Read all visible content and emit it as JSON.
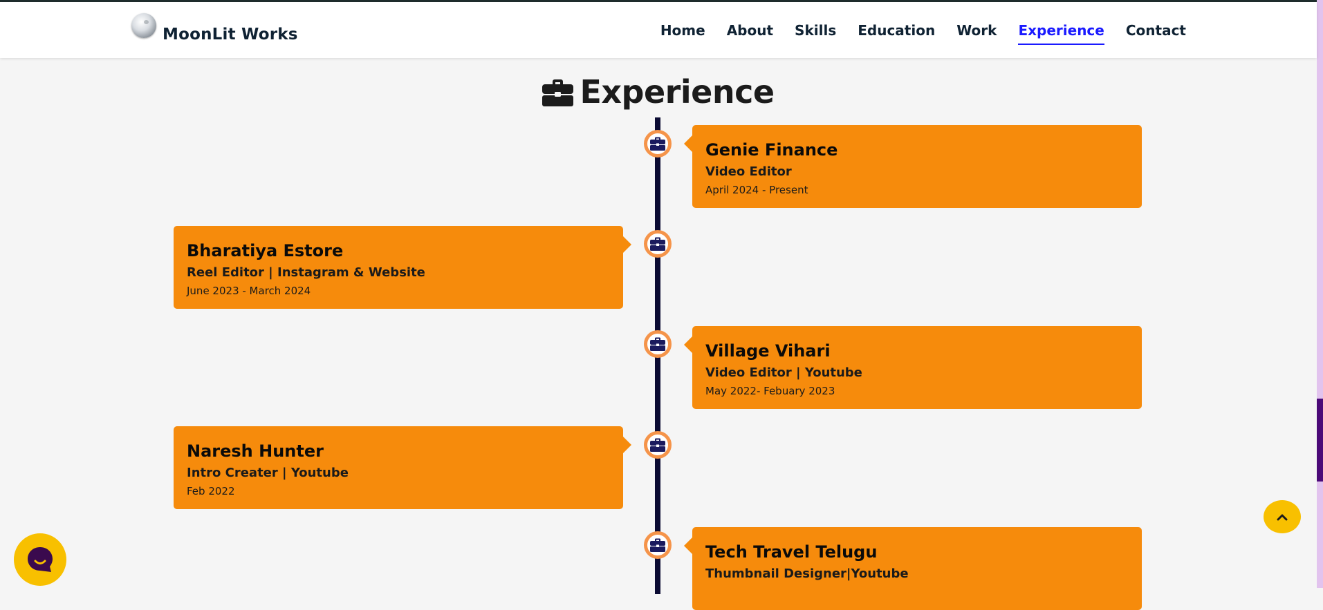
{
  "brand": {
    "name": "MoonLit Works",
    "logo_icon": "moon-icon"
  },
  "nav": {
    "items": [
      {
        "label": "Home"
      },
      {
        "label": "About"
      },
      {
        "label": "Skills"
      },
      {
        "label": "Education"
      },
      {
        "label": "Work"
      },
      {
        "label": "Experience",
        "active": true
      },
      {
        "label": "Contact"
      }
    ]
  },
  "section": {
    "title": "Experience",
    "icon": "briefcase-icon"
  },
  "experience": [
    {
      "company": "Genie Finance",
      "role": "Video Editor",
      "dates": "April 2024 - Present",
      "side": "right"
    },
    {
      "company": "Bharatiya Estore",
      "role": "Reel Editor | Instagram & Website",
      "dates": "June 2023 - March 2024",
      "side": "left"
    },
    {
      "company": "Village Vihari",
      "role": "Video Editor | Youtube",
      "dates": "May 2022- Febuary 2023",
      "side": "right"
    },
    {
      "company": "Naresh Hunter",
      "role": "Intro Creater | Youtube",
      "dates": "Feb 2022",
      "side": "left"
    },
    {
      "company": "Tech Travel Telugu",
      "role": "Thumbnail Designer|Youtube",
      "dates": "",
      "side": "right"
    }
  ],
  "colors": {
    "card": "#f68b0c",
    "timeline": "#0b0b33",
    "node_ring": "#f5944a",
    "nav_active": "#1a1aff",
    "floating_buttons": "#f8c000"
  },
  "floating": {
    "chat_icon": "chat-bubble-icon",
    "scroll_top_icon": "chevron-up-icon"
  }
}
